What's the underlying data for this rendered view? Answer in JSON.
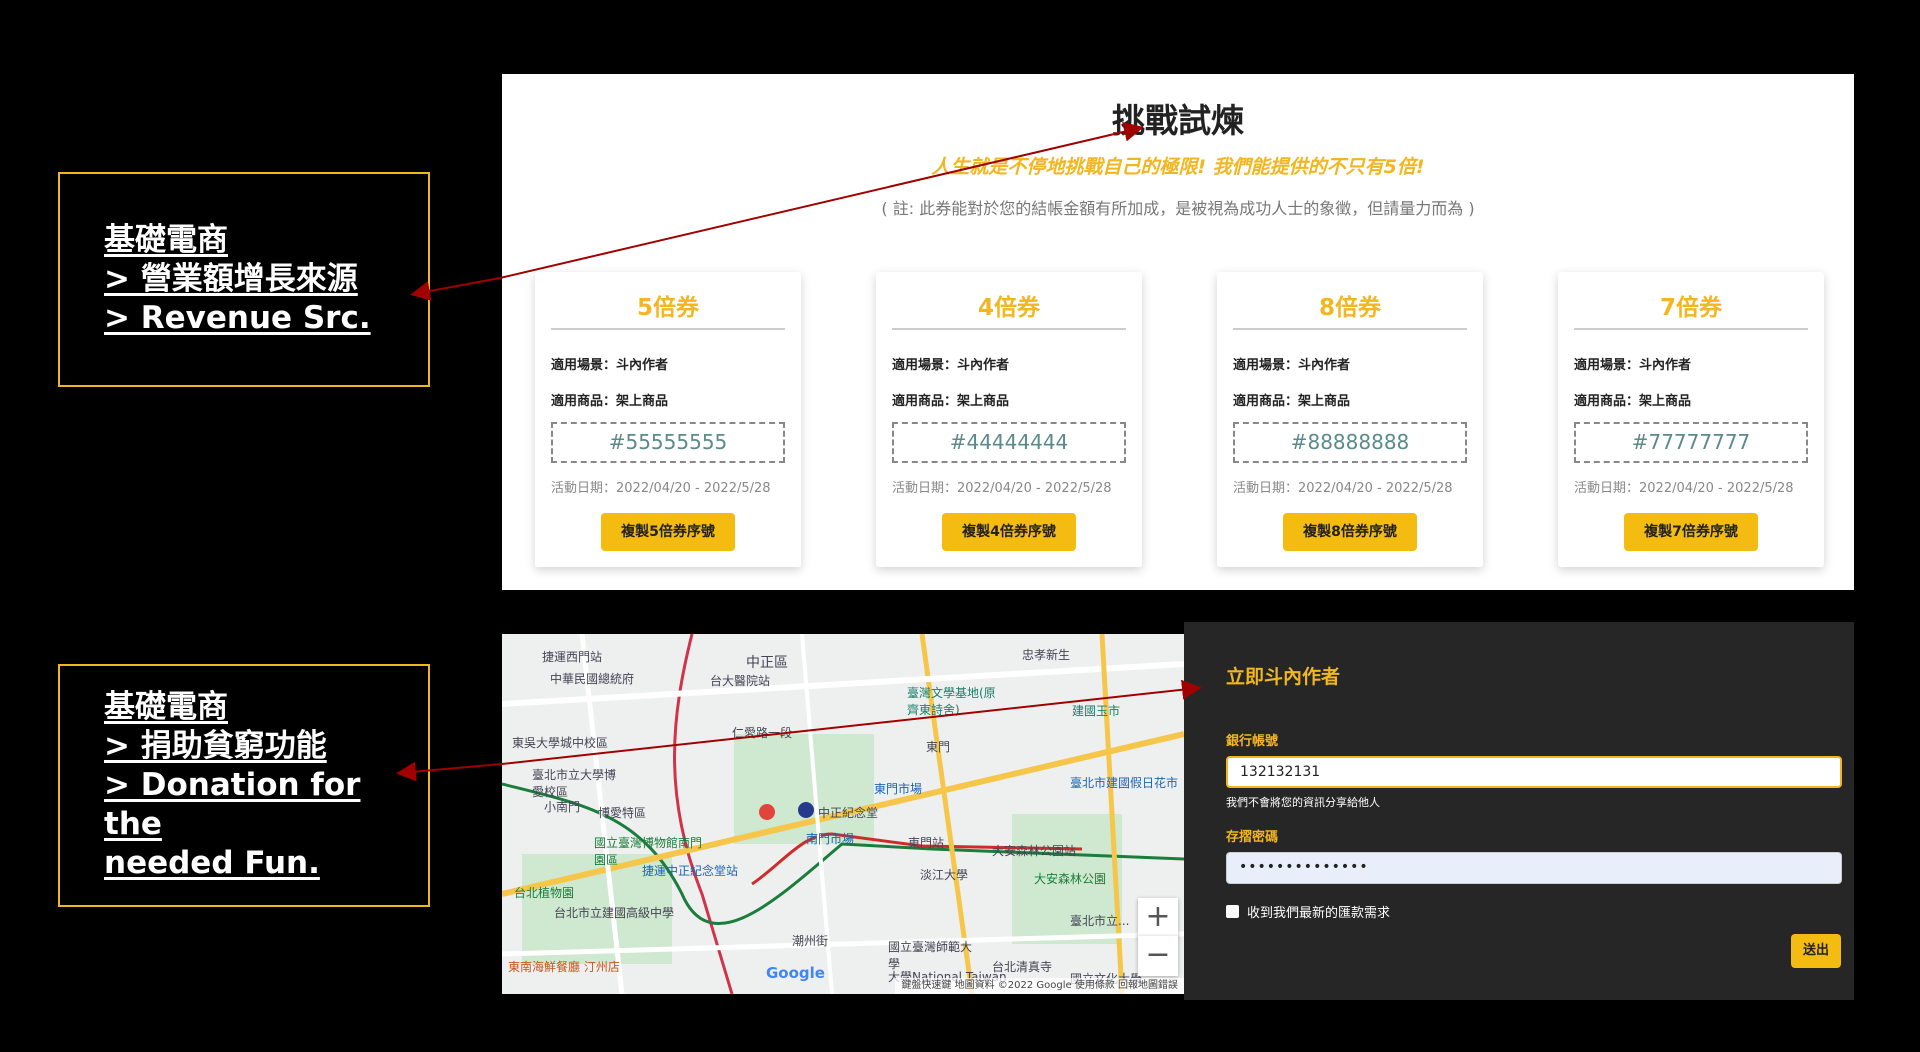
{
  "callouts": [
    {
      "lines": [
        "基礎電商",
        "> 營業額增長來源",
        "> Revenue Src."
      ]
    },
    {
      "lines": [
        "基礎電商",
        "> 捐助貧窮功能",
        "> Donation for the",
        "needed Fun."
      ]
    }
  ],
  "challenge": {
    "title": "挑戰試煉",
    "subtitle": "人生就是不停地挑戰自己的極限! 我們能提供的不只有5倍!",
    "note": "( 註: 此券能對於您的結帳金額有所加成，是被視為成功人士的象徵，但請量力而為 )",
    "coupons": [
      {
        "title": "5倍券",
        "scene": "適用場景：斗內作者",
        "product": "適用商品：架上商品",
        "code": "#55555555",
        "date": "活動日期：2022/04/20 - 2022/5/28",
        "button": "複製5倍券序號"
      },
      {
        "title": "4倍券",
        "scene": "適用場景：斗內作者",
        "product": "適用商品：架上商品",
        "code": "#44444444",
        "date": "活動日期：2022/04/20 - 2022/5/28",
        "button": "複製4倍券序號"
      },
      {
        "title": "8倍券",
        "scene": "適用場景：斗內作者",
        "product": "適用商品：架上商品",
        "code": "#88888888",
        "date": "活動日期：2022/04/20 - 2022/5/28",
        "button": "複製8倍券序號"
      },
      {
        "title": "7倍券",
        "scene": "適用場景：斗內作者",
        "product": "適用商品：架上商品",
        "code": "#77777777",
        "date": "活動日期：2022/04/20 - 2022/5/28",
        "button": "複製7倍券序號"
      }
    ]
  },
  "map": {
    "labels": [
      "捷運西門站",
      "中華民國總統府",
      "台大醫院站",
      "中正區",
      "臺灣文學基地(原齊東詩舍)",
      "忠孝新生",
      "東吳大學城中校區",
      "仁愛路一段",
      "東門",
      "建國玉市",
      "臺北市立大學博愛校區",
      "中正紀念堂",
      "東門市場",
      "臺北市建國假日花市",
      "小南門",
      "博愛特區",
      "南門市場",
      "東門站",
      "大安森林公園站",
      "國立臺灣博物館南門園區",
      "捷運中正紀念堂站",
      "淡江大學",
      "大安森林公園",
      "台北植物園",
      "台北市立建國高級中學",
      "臺北市立...",
      "潮州街",
      "國立臺灣師範大學",
      "台北清真寺",
      "大學National Taiwan",
      "東南海鮮餐廳 汀州店",
      "國立文化大學"
    ],
    "google": "Google",
    "footer": "鍵盤快速鍵   地圖資料 ©2022 Google   使用條款   回報地圖錯誤",
    "zoom_in": "+",
    "zoom_out": "−"
  },
  "form": {
    "heading": "立即斗內作者",
    "bank_label": "銀行帳號",
    "bank_value": "132132131",
    "help": "我們不會將您的資訊分享給他人",
    "password_label": "存摺密碼",
    "password_value": "••••••••••••••",
    "checkbox_label": "收到我們最新的匯款需求",
    "submit": "送出"
  },
  "colors": {
    "accent": "#f2b620",
    "button": "#f4bb11",
    "arrow": "#a00000",
    "code_text": "#5b8a8a"
  }
}
